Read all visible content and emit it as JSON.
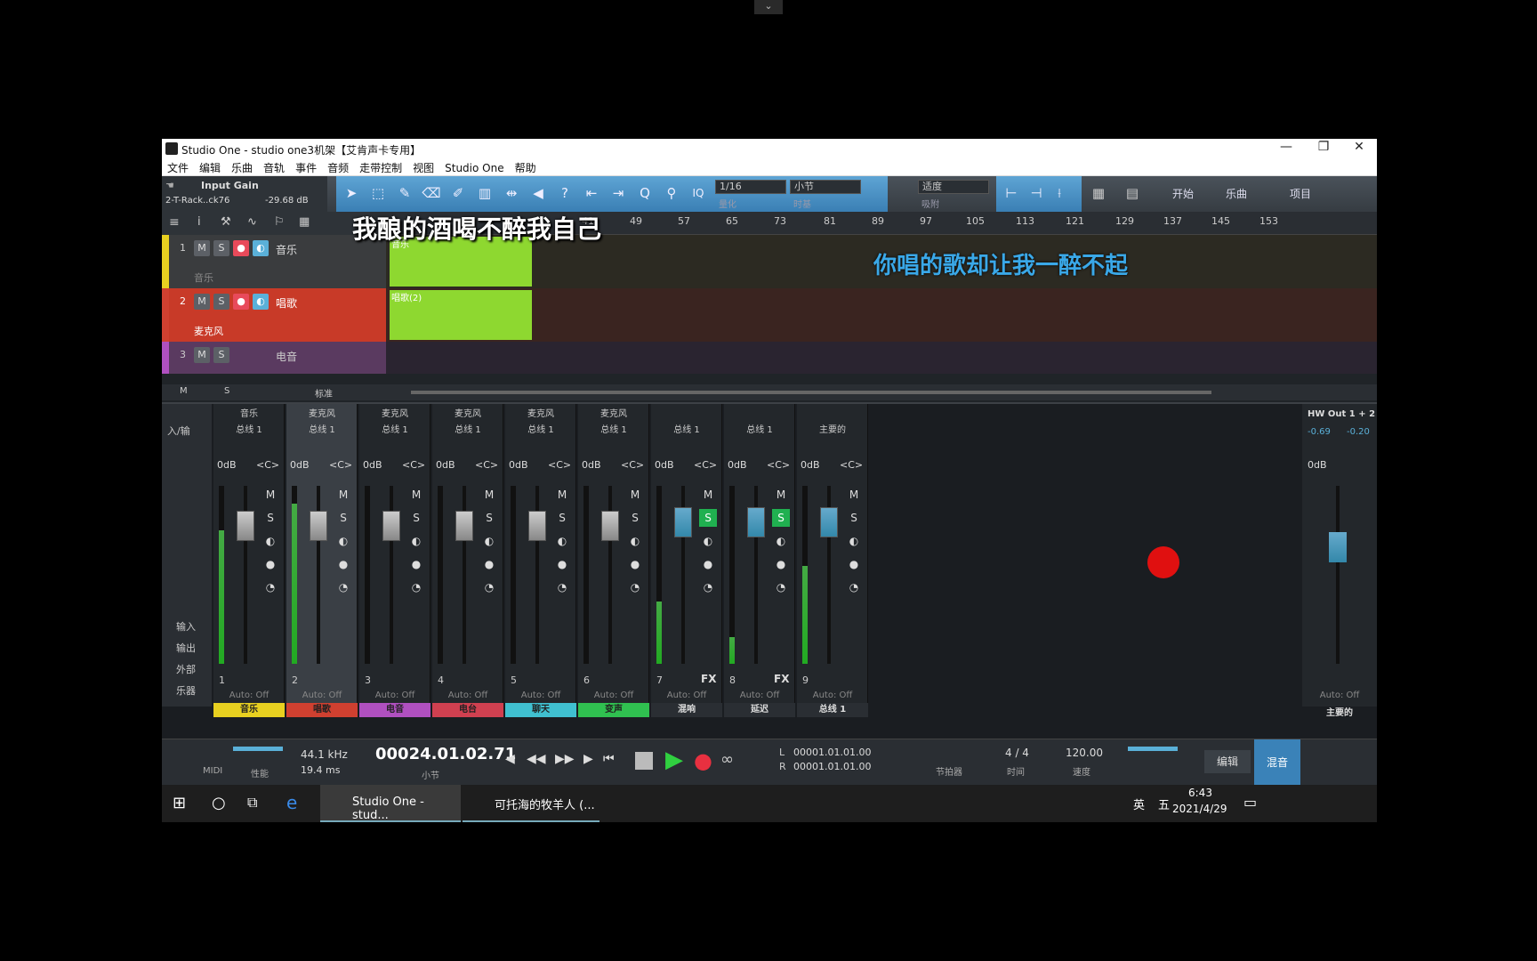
{
  "window": {
    "title": "Studio One - studio one3机架【艾肯声卡专用】",
    "minimize": "—",
    "maximize": "❐",
    "close": "✕"
  },
  "menu": [
    "文件",
    "编辑",
    "乐曲",
    "音轨",
    "事件",
    "音频",
    "走带控制",
    "视图",
    "Studio One",
    "帮助"
  ],
  "toolbar": {
    "gain_title": "Input Gain",
    "gain_device": "2-T-Rack..ck76",
    "gain_value": "-29.68 dB",
    "quantize": {
      "value": "1/16",
      "label": "量化"
    },
    "timebase": {
      "value": "小节",
      "label": "时基"
    },
    "snap": {
      "value": "适度",
      "label": "吸附"
    },
    "iq": "IQ",
    "nav": {
      "start": "开始",
      "song": "乐曲",
      "project": "项目"
    }
  },
  "ruler": {
    "ticks": [
      "41",
      "49",
      "57",
      "65",
      "73",
      "81",
      "89",
      "97",
      "105",
      "113",
      "121",
      "129",
      "137",
      "145",
      "153"
    ]
  },
  "lyrics": {
    "line1": "我酿的酒喝不醉我自己",
    "line2": "你唱的歌却让我一醉不起"
  },
  "tracks": [
    {
      "num": "1",
      "name": "音乐",
      "input": "音乐",
      "clip": "音乐",
      "color": "#e8d020"
    },
    {
      "num": "2",
      "name": "唱歌",
      "input": "麦克风",
      "clip": "唱歌(2)",
      "color": "#d04030"
    },
    {
      "num": "3",
      "name": "电音",
      "input": "",
      "clip": "",
      "color": "#b050c0"
    }
  ],
  "track_buttons": {
    "mute": "M",
    "solo": "S"
  },
  "track_footer": {
    "m": "M",
    "s": "S",
    "mode": "标准"
  },
  "mixer": {
    "left_labels": {
      "io": "入/输",
      "input": "输入",
      "output": "输出",
      "external": "外部",
      "instrument": "乐器"
    },
    "strips": [
      {
        "name": "音乐",
        "bus": "总线 1",
        "db": "0dB",
        "pan": "<C>",
        "num": "1",
        "auto": "Auto: Off",
        "label": "音乐",
        "color": "#e8d020",
        "fx": "",
        "meter": 0.75
      },
      {
        "name": "麦克风",
        "bus": "总线 1",
        "db": "0dB",
        "pan": "<C>",
        "num": "2",
        "auto": "Auto: Off",
        "label": "唱歌",
        "color": "#d04030",
        "fx": "",
        "meter": 0.9
      },
      {
        "name": "麦克风",
        "bus": "总线 1",
        "db": "0dB",
        "pan": "<C>",
        "num": "3",
        "auto": "Auto: Off",
        "label": "电音",
        "color": "#b050c0",
        "fx": "",
        "meter": 0
      },
      {
        "name": "麦克风",
        "bus": "总线 1",
        "db": "0dB",
        "pan": "<C>",
        "num": "4",
        "auto": "Auto: Off",
        "label": "电台",
        "color": "#d04050",
        "fx": "",
        "meter": 0
      },
      {
        "name": "麦克风",
        "bus": "总线 1",
        "db": "0dB",
        "pan": "<C>",
        "num": "5",
        "auto": "Auto: Off",
        "label": "聊天",
        "color": "#40c0d0",
        "fx": "",
        "meter": 0
      },
      {
        "name": "麦克风",
        "bus": "总线 1",
        "db": "0dB",
        "pan": "<C>",
        "num": "6",
        "auto": "Auto: Off",
        "label": "变声",
        "color": "#30c050",
        "fx": "",
        "meter": 0
      },
      {
        "name": "",
        "bus": "总线 1",
        "db": "0dB",
        "pan": "<C>",
        "num": "7",
        "auto": "Auto: Off",
        "label": "混响",
        "color": "#2a2e33",
        "fx": "FX",
        "meter": 0.35
      },
      {
        "name": "",
        "bus": "总线 1",
        "db": "0dB",
        "pan": "<C>",
        "num": "8",
        "auto": "Auto: Off",
        "label": "延迟",
        "color": "#2a2e33",
        "fx": "FX",
        "meter": 0.15
      },
      {
        "name": "",
        "bus": "主要的",
        "db": "0dB",
        "pan": "<C>",
        "num": "9",
        "auto": "Auto: Off",
        "label": "总线 1",
        "color": "#2a2e33",
        "fx": "",
        "meter": 0.55
      }
    ],
    "main": {
      "name": "HW Out 1 + 2",
      "l": "-0.69",
      "r": "-0.20",
      "db": "0dB",
      "auto": "Auto: Off",
      "label": "主要的"
    }
  },
  "transport": {
    "midi": "MIDI",
    "perf": "性能",
    "rate": "44.1 kHz",
    "latency": "19.4 ms",
    "position": "00024.01.02.71",
    "position_label": "小节",
    "loop_l": "00001.01.01.00",
    "loop_r": "00001.01.01.00",
    "l": "L",
    "r": "R",
    "metronome": "节拍器",
    "sig": "4 / 4",
    "sig_label": "时间",
    "tempo": "120.00",
    "tempo_label": "速度",
    "edit": "编辑",
    "mix": "混音"
  },
  "taskbar": {
    "app1": "Studio One - stud...",
    "app2": "可托海的牧羊人 (...",
    "ime1": "英",
    "ime2": "五",
    "time": "6:43",
    "date": "2021/4/29"
  }
}
